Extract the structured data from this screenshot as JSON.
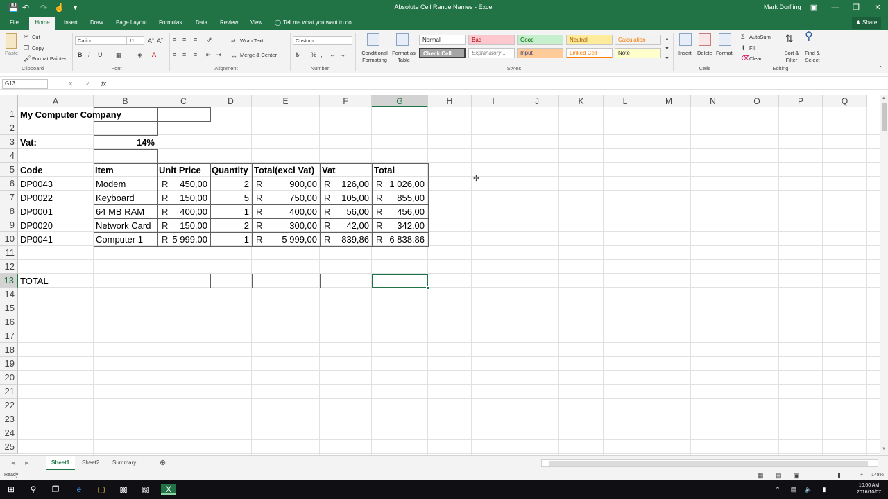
{
  "window": {
    "title": "Absolute Cell Range Names - Excel",
    "user": "Mark Dorfling",
    "share": "Share",
    "tell_me": "Tell me what you want to do"
  },
  "tabs": [
    "File",
    "Home",
    "Insert",
    "Draw",
    "Page Layout",
    "Formulas",
    "Data",
    "Review",
    "View"
  ],
  "ribbon": {
    "clipboard": {
      "paste": "Paste",
      "cut": "Cut",
      "copy": "Copy",
      "format_painter": "Format Painter",
      "group": "Clipboard"
    },
    "font": {
      "name": "Calibri",
      "size": "11",
      "group": "Font"
    },
    "alignment": {
      "wrap": "Wrap Text",
      "merge": "Merge & Center",
      "group": "Alignment"
    },
    "number": {
      "format": "Custom",
      "group": "Number"
    },
    "styles": {
      "conditional": "Conditional Formatting",
      "format_table": "Format as Table",
      "group": "Styles",
      "cells": [
        {
          "label": "Normal",
          "bg": "#ffffff",
          "fg": "#000000"
        },
        {
          "label": "Bad",
          "bg": "#ffc7ce",
          "fg": "#9c0006"
        },
        {
          "label": "Good",
          "bg": "#c6efce",
          "fg": "#006100"
        },
        {
          "label": "Neutral",
          "bg": "#ffeb9c",
          "fg": "#9c5700"
        },
        {
          "label": "Calculation",
          "bg": "#f2f2f2",
          "fg": "#fa7d00"
        },
        {
          "label": "Check Cell",
          "bg": "#a5a5a5",
          "fg": "#ffffff"
        },
        {
          "label": "Explanatory ...",
          "bg": "#ffffff",
          "fg": "#7f7f7f"
        },
        {
          "label": "Input",
          "bg": "#ffcc99",
          "fg": "#3f3f76"
        },
        {
          "label": "Linked Cell",
          "bg": "#ffffff",
          "fg": "#fa7d00"
        },
        {
          "label": "Note",
          "bg": "#ffffcc",
          "fg": "#000000"
        }
      ]
    },
    "cells": {
      "insert": "Insert",
      "delete": "Delete",
      "format": "Format",
      "group": "Cells"
    },
    "editing": {
      "autosum": "AutoSum",
      "fill": "Fill",
      "clear": "Clear",
      "sort": "Sort & Filter",
      "find": "Find & Select",
      "group": "Editing"
    }
  },
  "formula_bar": {
    "name_box": "G13",
    "fx": "fx",
    "content": ""
  },
  "columns": [
    "A",
    "B",
    "C",
    "D",
    "E",
    "F",
    "G",
    "H",
    "I",
    "J",
    "K",
    "L",
    "M",
    "N",
    "O",
    "P",
    "Q"
  ],
  "rows": [
    "1",
    "2",
    "3",
    "4",
    "5",
    "6",
    "7",
    "8",
    "9",
    "10",
    "11",
    "12",
    "13",
    "14",
    "15",
    "16",
    "17",
    "18",
    "19",
    "20",
    "21",
    "22",
    "23",
    "24",
    "25"
  ],
  "sheet": {
    "title": "My Computer Company",
    "vat_label": "Vat:",
    "vat_value": "14%",
    "headers": [
      "Code",
      "Item",
      "Unit Price",
      "Quantity",
      "Total(excl Vat)",
      "Vat",
      "Total"
    ],
    "currency": "R",
    "rows": [
      {
        "code": "DP0043",
        "item": "Modem",
        "unit_price": "450,00",
        "quantity": "2",
        "total_excl": "900,00",
        "vat": "126,00",
        "total": "1 026,00"
      },
      {
        "code": "DP0022",
        "item": "Keyboard",
        "unit_price": "150,00",
        "quantity": "5",
        "total_excl": "750,00",
        "vat": "105,00",
        "total": "855,00"
      },
      {
        "code": "DP0001",
        "item": "64 MB RAM",
        "unit_price": "400,00",
        "quantity": "1",
        "total_excl": "400,00",
        "vat": "56,00",
        "total": "456,00"
      },
      {
        "code": "DP0020",
        "item": "Network Card",
        "unit_price": "150,00",
        "quantity": "2",
        "total_excl": "300,00",
        "vat": "42,00",
        "total": "342,00"
      },
      {
        "code": "DP0041",
        "item": "Computer 1",
        "unit_price": "5 999,00",
        "quantity": "1",
        "total_excl": "5 999,00",
        "vat": "839,86",
        "total": "6 838,86"
      }
    ],
    "total_label": "TOTAL",
    "selected_cell": "G13"
  },
  "sheet_tabs": [
    "Sheet1",
    "Sheet2",
    "Summary"
  ],
  "status": {
    "ready": "Ready",
    "zoom": "148%"
  },
  "clock": {
    "time": "10:00 AM",
    "date": "2016/10/07"
  }
}
